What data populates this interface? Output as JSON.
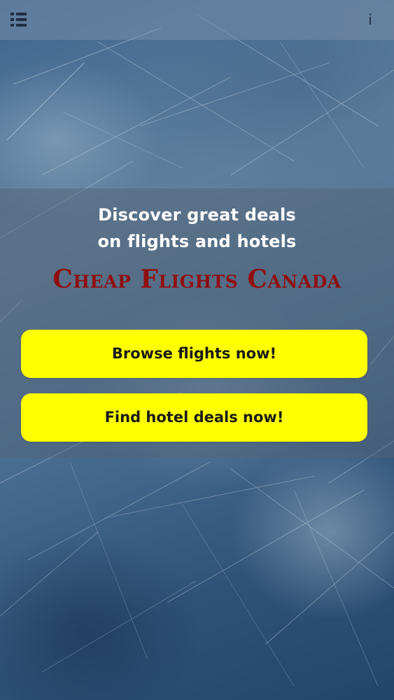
{
  "app": {
    "tagline_line1": "Discover great deals",
    "tagline_line2": "on flights and hotels",
    "brand": "Cheap Flights Canada"
  },
  "top_bar": {
    "menu_icon": "list-menu-icon",
    "info_label": "i",
    "info_icon": "info-icon"
  },
  "actions": {
    "browse_flights_label": "Browse flights now!",
    "find_hotels_label": "Find hotel deals now!"
  },
  "colors": {
    "brand": "#8e0f12",
    "button": "#ffff00",
    "button_text": "#1a1a1a",
    "tagline": "#ffffff"
  }
}
